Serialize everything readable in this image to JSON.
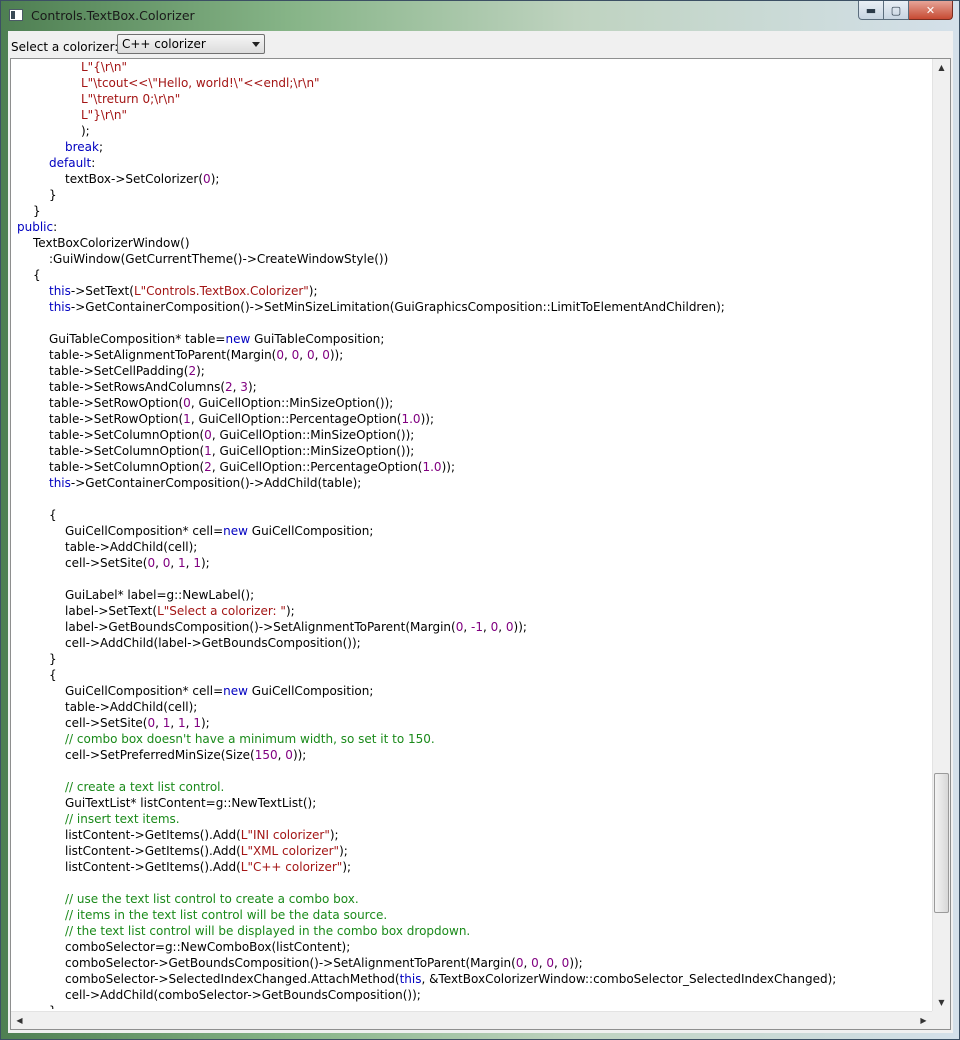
{
  "window": {
    "title": "Controls.TextBox.Colorizer",
    "buttons": {
      "minimize": "▬",
      "maximize": "▢",
      "close": "✕"
    }
  },
  "toolbar": {
    "select_label": "Select a colorizer:",
    "colorizer_value": "C++ colorizer"
  },
  "code_lines": [
    [
      [
        8,
        ""
      ],
      [
        "s",
        "L\"{\\r\\n\""
      ]
    ],
    [
      [
        8,
        ""
      ],
      [
        "s",
        "L\"\\tcout<<\\\"Hello, world!\\\"<<endl;\\r\\n\""
      ]
    ],
    [
      [
        8,
        ""
      ],
      [
        "s",
        "L\"\\treturn 0;\\r\\n\""
      ]
    ],
    [
      [
        8,
        ""
      ],
      [
        "s",
        "L\"}\\r\\n\""
      ]
    ],
    [
      [
        8,
        ""
      ],
      [
        "t",
        ");"
      ]
    ],
    [
      [
        6,
        ""
      ],
      [
        "k",
        "break"
      ],
      [
        "t",
        ";"
      ]
    ],
    [
      [
        4,
        ""
      ],
      [
        "k",
        "default"
      ],
      [
        "t",
        ":"
      ]
    ],
    [
      [
        6,
        ""
      ],
      [
        "t",
        "textBox->SetColorizer("
      ],
      [
        "n",
        "0"
      ],
      [
        "t",
        ");"
      ]
    ],
    [
      [
        4,
        ""
      ],
      [
        "t",
        "}"
      ]
    ],
    [
      [
        2,
        ""
      ],
      [
        "t",
        "}"
      ]
    ],
    [
      [
        0,
        ""
      ],
      [
        "k",
        "public"
      ],
      [
        "t",
        ":"
      ]
    ],
    [
      [
        2,
        ""
      ],
      [
        "t",
        "TextBoxColorizerWindow()"
      ]
    ],
    [
      [
        4,
        ""
      ],
      [
        "t",
        ":GuiWindow(GetCurrentTheme()->CreateWindowStyle())"
      ]
    ],
    [
      [
        2,
        ""
      ],
      [
        "t",
        "{"
      ]
    ],
    [
      [
        4,
        ""
      ],
      [
        "k",
        "this"
      ],
      [
        "t",
        "->SetText("
      ],
      [
        "s",
        "L\"Controls.TextBox.Colorizer\""
      ],
      [
        "t",
        ");"
      ]
    ],
    [
      [
        4,
        ""
      ],
      [
        "k",
        "this"
      ],
      [
        "t",
        "->GetContainerComposition()->SetMinSizeLimitation(GuiGraphicsComposition::LimitToElementAndChildren);"
      ]
    ],
    [
      [
        0,
        ""
      ]
    ],
    [
      [
        4,
        ""
      ],
      [
        "t",
        "GuiTableComposition* table="
      ],
      [
        "k",
        "new"
      ],
      [
        "t",
        " GuiTableComposition;"
      ]
    ],
    [
      [
        4,
        ""
      ],
      [
        "t",
        "table->SetAlignmentToParent(Margin("
      ],
      [
        "n",
        "0"
      ],
      [
        "t",
        ", "
      ],
      [
        "n",
        "0"
      ],
      [
        "t",
        ", "
      ],
      [
        "n",
        "0"
      ],
      [
        "t",
        ", "
      ],
      [
        "n",
        "0"
      ],
      [
        "t",
        "));"
      ]
    ],
    [
      [
        4,
        ""
      ],
      [
        "t",
        "table->SetCellPadding("
      ],
      [
        "n",
        "2"
      ],
      [
        "t",
        ");"
      ]
    ],
    [
      [
        4,
        ""
      ],
      [
        "t",
        "table->SetRowsAndColumns("
      ],
      [
        "n",
        "2"
      ],
      [
        "t",
        ", "
      ],
      [
        "n",
        "3"
      ],
      [
        "t",
        ");"
      ]
    ],
    [
      [
        4,
        ""
      ],
      [
        "t",
        "table->SetRowOption("
      ],
      [
        "n",
        "0"
      ],
      [
        "t",
        ", GuiCellOption::MinSizeOption());"
      ]
    ],
    [
      [
        4,
        ""
      ],
      [
        "t",
        "table->SetRowOption("
      ],
      [
        "n",
        "1"
      ],
      [
        "t",
        ", GuiCellOption::PercentageOption("
      ],
      [
        "n",
        "1.0"
      ],
      [
        "t",
        "));"
      ]
    ],
    [
      [
        4,
        ""
      ],
      [
        "t",
        "table->SetColumnOption("
      ],
      [
        "n",
        "0"
      ],
      [
        "t",
        ", GuiCellOption::MinSizeOption());"
      ]
    ],
    [
      [
        4,
        ""
      ],
      [
        "t",
        "table->SetColumnOption("
      ],
      [
        "n",
        "1"
      ],
      [
        "t",
        ", GuiCellOption::MinSizeOption());"
      ]
    ],
    [
      [
        4,
        ""
      ],
      [
        "t",
        "table->SetColumnOption("
      ],
      [
        "n",
        "2"
      ],
      [
        "t",
        ", GuiCellOption::PercentageOption("
      ],
      [
        "n",
        "1.0"
      ],
      [
        "t",
        "));"
      ]
    ],
    [
      [
        4,
        ""
      ],
      [
        "k",
        "this"
      ],
      [
        "t",
        "->GetContainerComposition()->AddChild(table);"
      ]
    ],
    [
      [
        0,
        ""
      ]
    ],
    [
      [
        4,
        ""
      ],
      [
        "t",
        "{"
      ]
    ],
    [
      [
        6,
        ""
      ],
      [
        "t",
        "GuiCellComposition* cell="
      ],
      [
        "k",
        "new"
      ],
      [
        "t",
        " GuiCellComposition;"
      ]
    ],
    [
      [
        6,
        ""
      ],
      [
        "t",
        "table->AddChild(cell);"
      ]
    ],
    [
      [
        6,
        ""
      ],
      [
        "t",
        "cell->SetSite("
      ],
      [
        "n",
        "0"
      ],
      [
        "t",
        ", "
      ],
      [
        "n",
        "0"
      ],
      [
        "t",
        ", "
      ],
      [
        "n",
        "1"
      ],
      [
        "t",
        ", "
      ],
      [
        "n",
        "1"
      ],
      [
        "t",
        ");"
      ]
    ],
    [
      [
        0,
        ""
      ]
    ],
    [
      [
        6,
        ""
      ],
      [
        "t",
        "GuiLabel* label=g::NewLabel();"
      ]
    ],
    [
      [
        6,
        ""
      ],
      [
        "t",
        "label->SetText("
      ],
      [
        "s",
        "L\"Select a colorizer: \""
      ],
      [
        "t",
        ");"
      ]
    ],
    [
      [
        6,
        ""
      ],
      [
        "t",
        "label->GetBoundsComposition()->SetAlignmentToParent(Margin("
      ],
      [
        "n",
        "0"
      ],
      [
        "t",
        ", "
      ],
      [
        "n",
        "-1"
      ],
      [
        "t",
        ", "
      ],
      [
        "n",
        "0"
      ],
      [
        "t",
        ", "
      ],
      [
        "n",
        "0"
      ],
      [
        "t",
        "));"
      ]
    ],
    [
      [
        6,
        ""
      ],
      [
        "t",
        "cell->AddChild(label->GetBoundsComposition());"
      ]
    ],
    [
      [
        4,
        ""
      ],
      [
        "t",
        "}"
      ]
    ],
    [
      [
        4,
        ""
      ],
      [
        "t",
        "{"
      ]
    ],
    [
      [
        6,
        ""
      ],
      [
        "t",
        "GuiCellComposition* cell="
      ],
      [
        "k",
        "new"
      ],
      [
        "t",
        " GuiCellComposition;"
      ]
    ],
    [
      [
        6,
        ""
      ],
      [
        "t",
        "table->AddChild(cell);"
      ]
    ],
    [
      [
        6,
        ""
      ],
      [
        "t",
        "cell->SetSite("
      ],
      [
        "n",
        "0"
      ],
      [
        "t",
        ", "
      ],
      [
        "n",
        "1"
      ],
      [
        "t",
        ", "
      ],
      [
        "n",
        "1"
      ],
      [
        "t",
        ", "
      ],
      [
        "n",
        "1"
      ],
      [
        "t",
        ");"
      ]
    ],
    [
      [
        6,
        ""
      ],
      [
        "c",
        "// combo box doesn't have a minimum width, so set it to 150."
      ]
    ],
    [
      [
        6,
        ""
      ],
      [
        "t",
        "cell->SetPreferredMinSize(Size("
      ],
      [
        "n",
        "150"
      ],
      [
        "t",
        ", "
      ],
      [
        "n",
        "0"
      ],
      [
        "t",
        "));"
      ]
    ],
    [
      [
        0,
        ""
      ]
    ],
    [
      [
        6,
        ""
      ],
      [
        "c",
        "// create a text list control."
      ]
    ],
    [
      [
        6,
        ""
      ],
      [
        "t",
        "GuiTextList* listContent=g::NewTextList();"
      ]
    ],
    [
      [
        6,
        ""
      ],
      [
        "c",
        "// insert text items."
      ]
    ],
    [
      [
        6,
        ""
      ],
      [
        "t",
        "listContent->GetItems().Add("
      ],
      [
        "s",
        "L\"INI colorizer\""
      ],
      [
        "t",
        ");"
      ]
    ],
    [
      [
        6,
        ""
      ],
      [
        "t",
        "listContent->GetItems().Add("
      ],
      [
        "s",
        "L\"XML colorizer\""
      ],
      [
        "t",
        ");"
      ]
    ],
    [
      [
        6,
        ""
      ],
      [
        "t",
        "listContent->GetItems().Add("
      ],
      [
        "s",
        "L\"C++ colorizer\""
      ],
      [
        "t",
        ");"
      ]
    ],
    [
      [
        0,
        ""
      ]
    ],
    [
      [
        6,
        ""
      ],
      [
        "c",
        "// use the text list control to create a combo box."
      ]
    ],
    [
      [
        6,
        ""
      ],
      [
        "c",
        "// items in the text list control will be the data source."
      ]
    ],
    [
      [
        6,
        ""
      ],
      [
        "c",
        "// the text list control will be displayed in the combo box dropdown."
      ]
    ],
    [
      [
        6,
        ""
      ],
      [
        "t",
        "comboSelector=g::NewComboBox(listContent);"
      ]
    ],
    [
      [
        6,
        ""
      ],
      [
        "t",
        "comboSelector->GetBoundsComposition()->SetAlignmentToParent(Margin("
      ],
      [
        "n",
        "0"
      ],
      [
        "t",
        ", "
      ],
      [
        "n",
        "0"
      ],
      [
        "t",
        ", "
      ],
      [
        "n",
        "0"
      ],
      [
        "t",
        ", "
      ],
      [
        "n",
        "0"
      ],
      [
        "t",
        "));"
      ]
    ],
    [
      [
        6,
        ""
      ],
      [
        "t",
        "comboSelector->SelectedIndexChanged.AttachMethod("
      ],
      [
        "k",
        "this"
      ],
      [
        "t",
        ", &TextBoxColorizerWindow::comboSelector_SelectedIndexChanged);"
      ]
    ],
    [
      [
        6,
        ""
      ],
      [
        "t",
        "cell->AddChild(comboSelector->GetBoundsComposition());"
      ]
    ],
    [
      [
        4,
        ""
      ],
      [
        "t",
        "}"
      ]
    ]
  ],
  "colors": {
    "keyword": "#0000c0",
    "string": "#a31515",
    "number": "#800080",
    "comment": "#1a8a1a"
  },
  "icons": {
    "up": "triangle-up",
    "down": "triangle-down",
    "left": "triangle-left",
    "right": "triangle-right"
  }
}
